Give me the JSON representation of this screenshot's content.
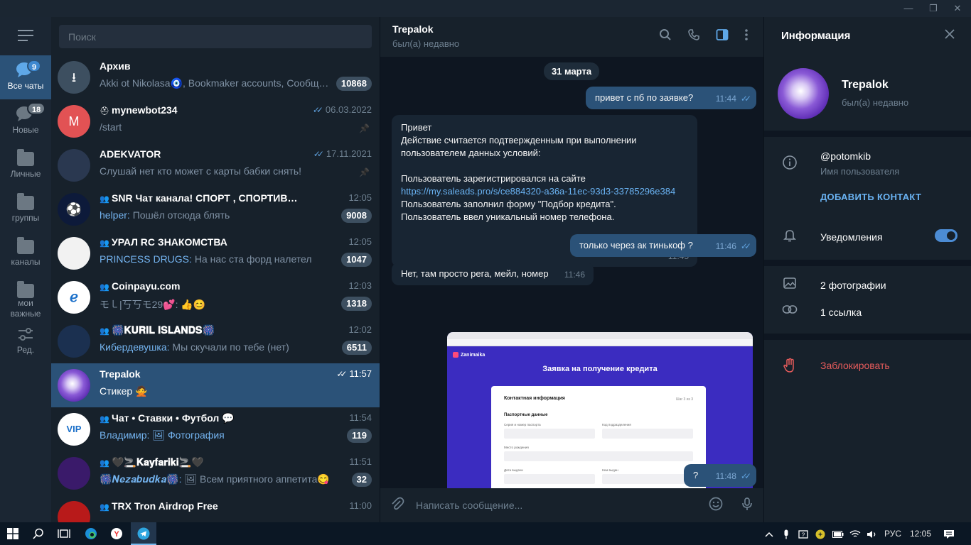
{
  "window": {
    "minimize": "—",
    "maximize": "❐",
    "close": "✕"
  },
  "folders": [
    {
      "label": "Все чаты",
      "badge": "9",
      "active": true,
      "icon": "chat-bubbles-icon"
    },
    {
      "label": "Новые",
      "badge": "18",
      "active": false,
      "icon": "chat-bubble-icon"
    },
    {
      "label": "Личные",
      "badge": "",
      "active": false,
      "icon": "folder-icon"
    },
    {
      "label": "группы",
      "badge": "",
      "active": false,
      "icon": "folder-icon"
    },
    {
      "label": "каналы",
      "badge": "",
      "active": false,
      "icon": "folder-icon"
    },
    {
      "label": "мои важные",
      "badge": "",
      "active": false,
      "icon": "folder-icon"
    },
    {
      "label": "Ред.",
      "badge": "",
      "active": false,
      "icon": "sliders-icon"
    }
  ],
  "search": {
    "placeholder": "Поиск"
  },
  "chats": [
    {
      "name": "Архив",
      "time": "",
      "sender": "",
      "preview": "Akki ot Nikolasa🧿, Bookmaker accounts, Сообщес…",
      "badge": "10868",
      "pinned": false,
      "group": false,
      "checks": false,
      "avatar_color": "#3d4f60",
      "avatar_text": "⭳"
    },
    {
      "name": "mynewbot234",
      "time": "06.03.2022",
      "sender": "",
      "preview": "/start",
      "badge": "",
      "pinned": true,
      "group": false,
      "bot": true,
      "checks": true,
      "avatar_color": "#e25254",
      "avatar_text": "M"
    },
    {
      "name": "ADEKVATOR",
      "time": "17.11.2021",
      "sender": "",
      "preview": "Слушай нет кто может с карты бабки  снять!",
      "badge": "",
      "pinned": true,
      "group": false,
      "checks": true,
      "avatar_color": "#2a3850",
      "avatar_text": ""
    },
    {
      "name": "SNR Чат канала! СПОРТ , СПОРТИВНЫЕ ПРОГНО…",
      "time": "12:05",
      "sender": "helper: ",
      "preview": "Пошёл отсюда блять",
      "badge": "9008",
      "pinned": false,
      "group": true,
      "checks": false,
      "avatar_color": "#0d1a3a",
      "avatar_text": "⚽"
    },
    {
      "name": "УРАЛ RC ЗНАКОМСТВА",
      "time": "12:05",
      "sender": "PRINCESS DRUGS: ",
      "preview": "На нас ста форд налетел",
      "badge": "1047",
      "pinned": false,
      "group": true,
      "checks": false,
      "avatar_color": "#f2f2f2",
      "avatar_text": ""
    },
    {
      "name": "Coinpayu.com",
      "time": "12:03",
      "sender": "",
      "preview": "モ㇄|丂丂モ29💕: 👍😊",
      "badge": "1318",
      "pinned": false,
      "group": true,
      "checks": false,
      "avatar_color": "#ffffff",
      "avatar_text": "ℯ"
    },
    {
      "name": "🎆𝐊𝐔𝐑𝐈𝐋 𝐈𝐒𝐋𝐀𝐍𝐃𝐒🎆",
      "time": "12:02",
      "sender": "Кибердевушка: ",
      "preview": "Мы скучали по тебе (нет)",
      "badge": "6511",
      "pinned": false,
      "group": true,
      "checks": false,
      "avatar_color": "#1b3050",
      "avatar_text": ""
    },
    {
      "name": "Trepalok",
      "time": "11:57",
      "sender": "",
      "preview": "Стикер 🙅",
      "badge": "",
      "pinned": false,
      "group": false,
      "checks": true,
      "active": true,
      "avatar_color": "#7a4cc8",
      "avatar_text": ""
    },
    {
      "name": "Чат • Ставки • Футбол 💬",
      "time": "11:54",
      "sender": "Владимир: ",
      "preview": "🖼 Фотография",
      "badge": "119",
      "pinned": false,
      "group": true,
      "checks": false,
      "avatar_color": "#ffffff",
      "avatar_text": "VIP"
    },
    {
      "name": "🖤🚬𝐊𝐚𝐲𝐟𝐚𝐫𝐢𝐤𝐢🚬🖤",
      "time": "11:51",
      "sender": "🎆𝑵𝒆𝒛𝒂𝒃𝒖𝒅𝒌𝒂🎆: ",
      "preview": "🖼 Всем приятного аппетита😋",
      "badge": "32",
      "pinned": false,
      "group": true,
      "checks": false,
      "avatar_color": "#3a1a6a",
      "avatar_text": ""
    },
    {
      "name": "TRX Tron Airdrop Free",
      "time": "11:00",
      "sender": "",
      "preview": "",
      "badge": "",
      "pinned": false,
      "group": true,
      "checks": false,
      "avatar_color": "#b81a1a",
      "avatar_text": ""
    }
  ],
  "conversation": {
    "name": "Trepalok",
    "status": "был(а) недавно",
    "date": "31 марта",
    "messages": [
      {
        "dir": "out",
        "text": "привет с пб  по заявке?",
        "time": "11:44",
        "read": true
      },
      {
        "dir": "in",
        "text": "Привет\nДействие считается подтвержденным при выполнении\nпользователем данных условий:\n\nПользователь зарегистрировался на сайте",
        "link": "https://my.saleads.pro/s/ce884320-a36a-11ec-93d3-33785296e384",
        "text2": "Пользователь заполнил форму \"Подбор кредита\".\nПользователь ввел уникальный номер телефона.",
        "time": "11:45"
      },
      {
        "dir": "out",
        "text": "только через ак тинькоф ?",
        "time": "11:46",
        "read": true
      },
      {
        "dir": "in",
        "text": "Нет, там просто рега, мейл, номер",
        "time": "11:46"
      },
      {
        "dir": "out",
        "text": "?",
        "time": "11:48",
        "read": true
      }
    ],
    "screenshot": {
      "logo": "Zanimaika",
      "title": "Заявка на получение кредита",
      "card_title": "Контактная информация",
      "step": "Шаг 3 из 3",
      "section": "Паспортные данные",
      "field1": "Серия и номер паспорта",
      "field2": "Код подразделения",
      "field3": "Место рождения",
      "field4": "Дата выдачи",
      "field5": "Кем выдан"
    },
    "composer_placeholder": "Написать сообщение..."
  },
  "info": {
    "title": "Информация",
    "name": "Trepalok",
    "status": "был(а) недавно",
    "username": "@potomkib",
    "username_label": "Имя пользователя",
    "add_contact": "ДОБАВИТЬ КОНТАКТ",
    "notifications": "Уведомления",
    "notifications_on": true,
    "photos": "2 фотографии",
    "links": "1 ссылка",
    "block": "Заблокировать"
  },
  "taskbar": {
    "lang": "РУС",
    "time": "12:05"
  },
  "colors": {
    "accent": "#2b5278",
    "link": "#6ab3f3",
    "danger": "#e55b5b"
  }
}
